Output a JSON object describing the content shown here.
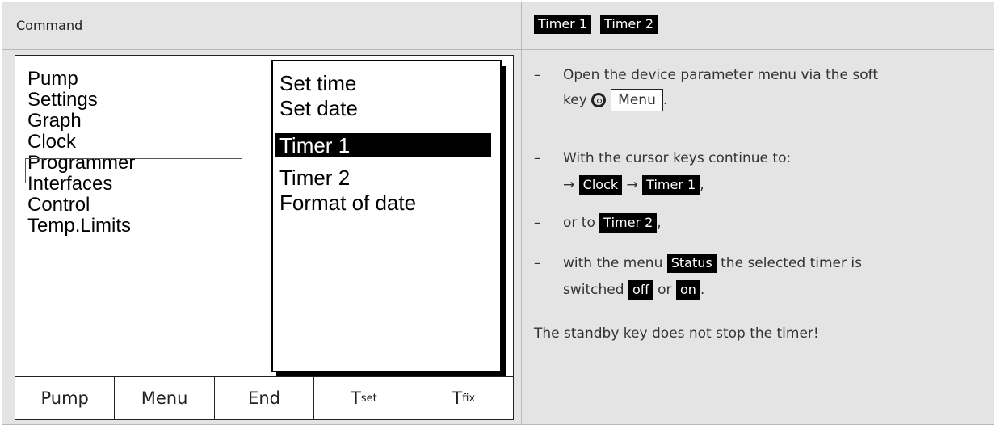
{
  "header": {
    "left": "Command",
    "right_tags": [
      "Timer 1",
      "Timer 2"
    ]
  },
  "display": {
    "main_menu": [
      "Pump",
      "Settings",
      "Graph",
      "Clock",
      "Programmer",
      "Interfaces",
      "Control",
      "Temp.Limits"
    ],
    "selected_main": "Clock",
    "submenu": [
      "Set time",
      "Set date",
      "Timer 1",
      "Timer 2",
      "Format of date"
    ],
    "highlighted_sub": "Timer 1",
    "softkeys": {
      "pump": "Pump",
      "menu": "Menu",
      "end": "End",
      "tset_main": "T",
      "tset_sub": "set",
      "tfix_main": "T",
      "tfix_sub": "fix"
    }
  },
  "instructions": {
    "step1_text": "Open the device parameter menu via the soft",
    "step1_key": "key",
    "step1_menu": "Menu",
    "step2_text": "With the cursor keys continue to:",
    "step2_arrow": "→",
    "step2_clock": "Clock",
    "step2_timer1": "Timer 1",
    "step3_prefix": "or to",
    "step3_timer2": "Timer 2",
    "step4_prefix": "with the menu",
    "step4_status": "Status",
    "step4_suffix": "the selected timer is",
    "step4b_prefix": "switched",
    "step4b_off": "off",
    "step4b_or": "or",
    "step4b_on": "on",
    "dash": "–",
    "comma": ",",
    "period": ".",
    "note": "The standby key does not stop the timer!"
  }
}
